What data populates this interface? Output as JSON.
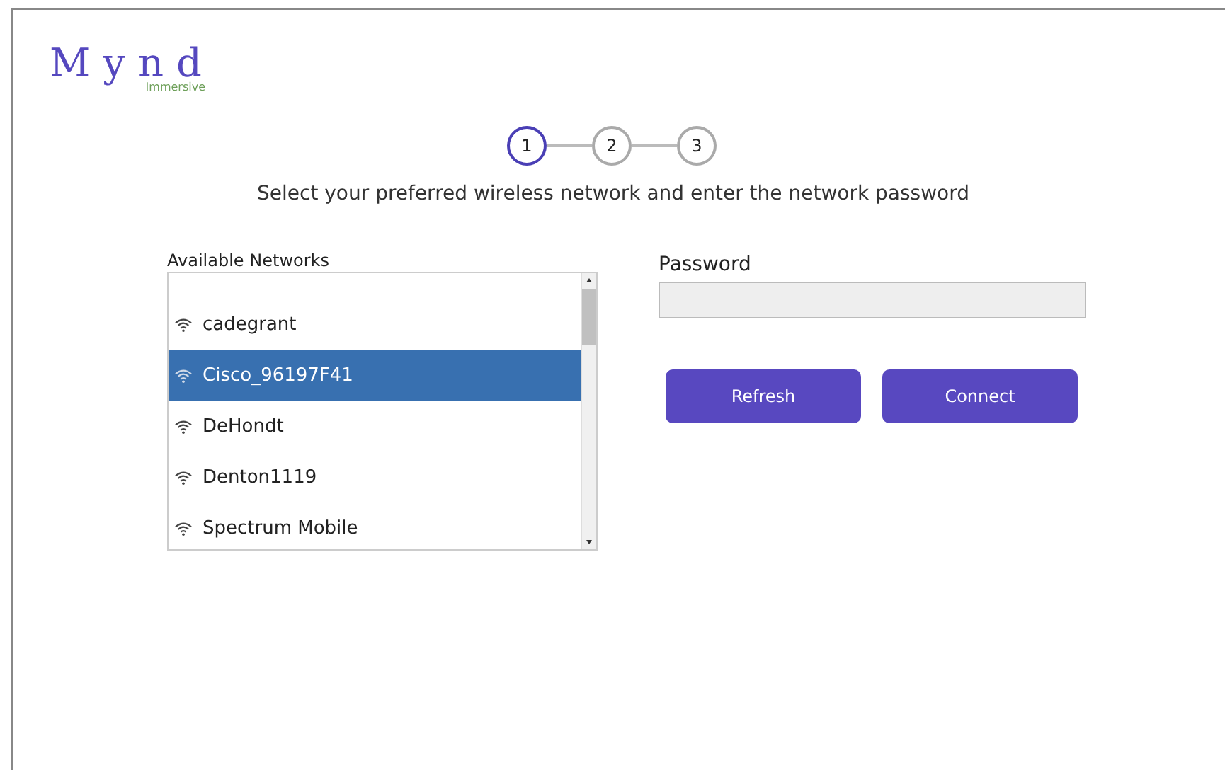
{
  "logo": {
    "name": "Mynd",
    "tagline": "Immersive"
  },
  "steps": [
    {
      "label": "1",
      "selected": true
    },
    {
      "label": "2",
      "selected": false
    },
    {
      "label": "3",
      "selected": false
    }
  ],
  "instruction": "Select your preferred wireless network and enter the network password",
  "networks": {
    "label": "Available Networks",
    "items": [
      {
        "name": "cadegrant",
        "selected": false
      },
      {
        "name": "Cisco_96197F41",
        "selected": true
      },
      {
        "name": "DeHondt",
        "selected": false
      },
      {
        "name": "Denton1119",
        "selected": false
      },
      {
        "name": "Spectrum Mobile",
        "selected": false
      }
    ]
  },
  "password": {
    "label": "Password"
  },
  "buttons": [
    "Refresh",
    "Connect"
  ]
}
